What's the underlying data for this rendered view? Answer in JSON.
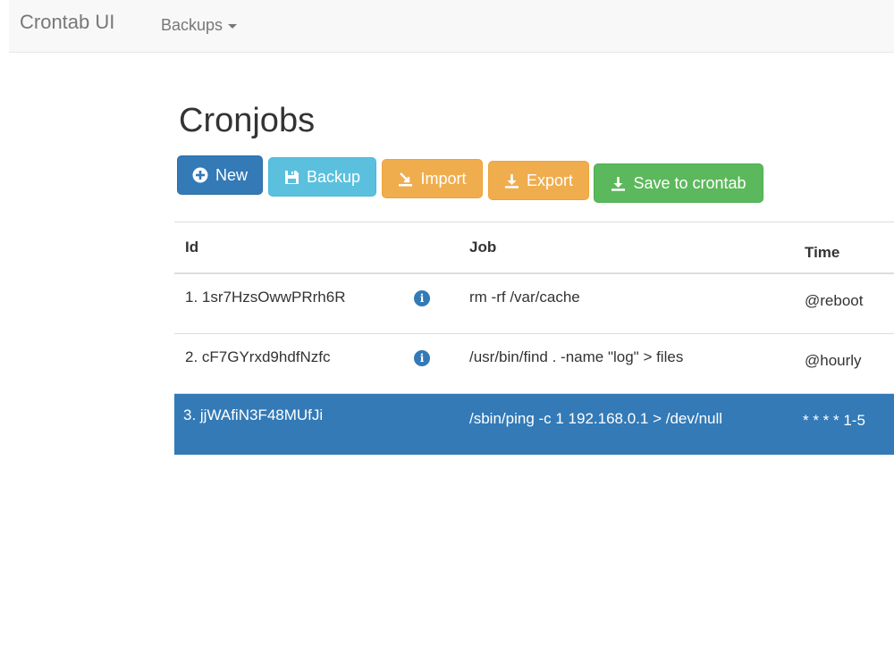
{
  "navbar": {
    "brand": "Crontab UI",
    "menu_label": "Backups"
  },
  "page": {
    "title": "Cronjobs"
  },
  "toolbar": {
    "new_label": "New",
    "backup_label": "Backup",
    "import_label": "Import",
    "export_label": "Export",
    "save_label": "Save to crontab"
  },
  "table": {
    "headers": [
      "Id",
      "Job",
      "Time"
    ],
    "rows": [
      {
        "id": "1. 1sr7HzsOwwPRrh6R",
        "job": "rm -rf /var/cache",
        "time": "@reboot",
        "has_info": true
      },
      {
        "id": "2. cF7GYrxd9hdfNzfc",
        "job": "/usr/bin/find . -name \"log\" > files",
        "time": "@hourly",
        "has_info": true
      },
      {
        "id": "3. jjWAfiN3F48MUfJi",
        "job": "/sbin/ping -c 1 192.168.0.1 > /dev/null",
        "time": "* * * * 1-5",
        "has_info": false,
        "selected": true
      }
    ]
  },
  "colors": {
    "primary": "#337ab7",
    "info": "#5bc0de",
    "warning": "#f0ad4e",
    "success": "#5cb85c"
  },
  "icons": {
    "new": "plus-circle-icon",
    "backup": "floppy-disk-icon",
    "import": "import-icon",
    "export": "download-icon",
    "save": "download-icon",
    "row_info": "info-icon"
  }
}
